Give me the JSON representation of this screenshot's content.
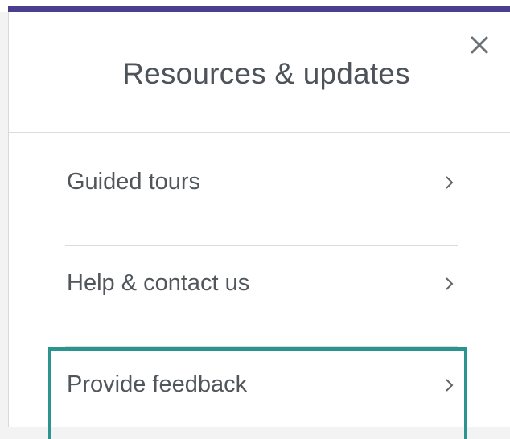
{
  "panel": {
    "title": "Resources & updates",
    "close_icon": "close-icon",
    "accent_color": "#4a3f8f",
    "focus_color": "#2a9490"
  },
  "menu": {
    "items": [
      {
        "label": "Guided tours",
        "icon": "chevron-right-icon"
      },
      {
        "label": "Help & contact us",
        "icon": "chevron-right-icon"
      },
      {
        "label": "Provide feedback",
        "icon": "chevron-right-icon",
        "focused": true
      }
    ]
  }
}
